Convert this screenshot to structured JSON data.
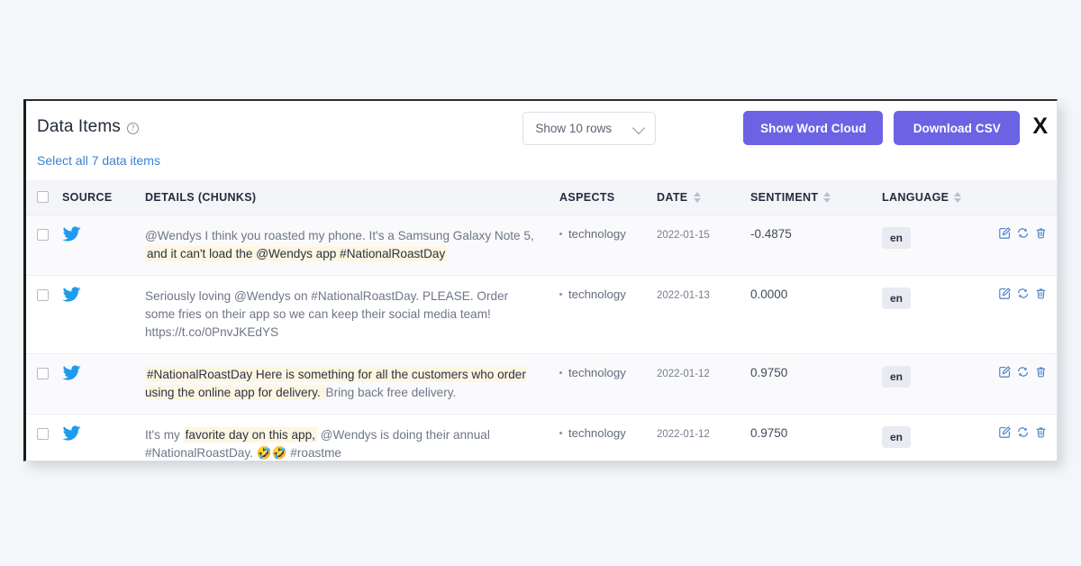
{
  "card": {
    "title": "Data Items",
    "help_icon": "question-circle-icon",
    "select_all_label": "Select all 7 data items",
    "close_label": "X"
  },
  "toolbar": {
    "rows_select_value": "Show 10 rows",
    "rows_select_icon": "chevron-down-icon",
    "word_cloud_label": "Show Word Cloud",
    "download_csv_label": "Download CSV",
    "accent_color": "#6b63e4"
  },
  "table": {
    "columns": [
      {
        "key": "check",
        "label": ""
      },
      {
        "key": "source",
        "label": "SOURCE"
      },
      {
        "key": "details",
        "label": "DETAILS (CHUNKS)"
      },
      {
        "key": "aspects",
        "label": "ASPECTS"
      },
      {
        "key": "date",
        "label": "DATE",
        "sortable": true
      },
      {
        "key": "sent",
        "label": "SENTIMENT",
        "sortable": true
      },
      {
        "key": "lang",
        "label": "LANGUAGE",
        "sortable": true
      },
      {
        "key": "actions",
        "label": ""
      }
    ],
    "row_actions": [
      "edit-icon",
      "refresh-icon",
      "delete-icon"
    ],
    "rows": [
      {
        "source_icon": "twitter-icon",
        "segments": [
          {
            "text": "@Wendys I think you roasted my phone. It's a Samsung Galaxy Note 5, ",
            "highlight": false
          },
          {
            "text": "and it can't load the @Wendys app #NationalRoastDay",
            "highlight": true
          }
        ],
        "aspect": "technology",
        "date": "2022-01-15",
        "sentiment": "-0.4875",
        "language": "en"
      },
      {
        "source_icon": "twitter-icon",
        "segments": [
          {
            "text": "Seriously loving @Wendys on #NationalRoastDay. PLEASE. Order some fries on their app so we can keep their social media team! https://t.co/0PnvJKEdYS",
            "highlight": false
          }
        ],
        "aspect": "technology",
        "date": "2022-01-13",
        "sentiment": "0.0000",
        "language": "en"
      },
      {
        "source_icon": "twitter-icon",
        "segments": [
          {
            "text": "#NationalRoastDay Here is something for all the customers who order using the online app for delivery. ",
            "highlight": true
          },
          {
            "text": "Bring back free delivery.",
            "highlight": false
          }
        ],
        "aspect": "technology",
        "date": "2022-01-12",
        "sentiment": "0.9750",
        "language": "en"
      },
      {
        "source_icon": "twitter-icon",
        "segments": [
          {
            "text": "It's my ",
            "highlight": false
          },
          {
            "text": "favorite day on this app,",
            "highlight": true
          },
          {
            "text": " @Wendys is doing their annual #NationalRoastDay. 🤣🤣 #roastme",
            "highlight": false
          }
        ],
        "aspect": "technology",
        "date": "2022-01-12",
        "sentiment": "0.9750",
        "language": "en"
      }
    ]
  }
}
